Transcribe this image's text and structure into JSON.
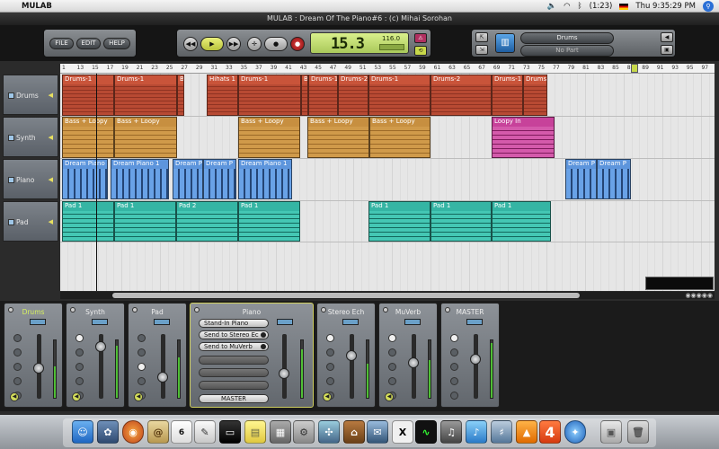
{
  "menubar": {
    "app_name": "MULAB",
    "battery": "(1:23)",
    "clock": "Thu 9:35:29 PM"
  },
  "window": {
    "title": "MULAB : Dream Of The Piano#6 : (c) Mihai Sorohan"
  },
  "toolbar": {
    "file_label": "FILE",
    "edit_label": "EDIT",
    "help_label": "HELP"
  },
  "transport": {
    "position": "15.3",
    "tempo": "116.0"
  },
  "instrument_panel": {
    "rack_name": "Drums",
    "part_name": "No Part"
  },
  "tracks": [
    {
      "name": "Drums"
    },
    {
      "name": "Synth"
    },
    {
      "name": "Piano"
    },
    {
      "name": "Pad"
    }
  ],
  "ruler": {
    "bars": [
      "1",
      "13",
      "15",
      "17",
      "19",
      "21",
      "23",
      "25",
      "27",
      "29",
      "31",
      "33",
      "35",
      "37",
      "39",
      "41",
      "43",
      "45",
      "47",
      "49",
      "51",
      "53",
      "55",
      "57",
      "59",
      "61",
      "63",
      "65",
      "67",
      "69",
      "71",
      "73",
      "75",
      "77",
      "79",
      "81",
      "83",
      "85",
      "87",
      "89",
      "91",
      "93",
      "95",
      "97"
    ]
  },
  "clips": {
    "drums": [
      "Drums-1",
      "Drums-1",
      "B",
      "Hihats 1",
      "Drums-1",
      "B",
      "Drums-1",
      "Drums-2",
      "Drums-1",
      "Drums-2",
      "Drums-1",
      "Drums"
    ],
    "synth": [
      "Bass + Loopy",
      "Bass + Loopy",
      "Bass + Loopy",
      "Bass + Loopy",
      "Bass + Loopy",
      "Bass + Loopy",
      "Loopy In"
    ],
    "piano": [
      "Dream Piano 1",
      "Dream Piano 1",
      "Dream P",
      "Dream P",
      "Dream Piano 1",
      "Dream P",
      "Dream P"
    ],
    "pad": [
      "Pad 1",
      "Pad 1",
      "Pad 2",
      "Pad 1",
      "Pad 1",
      "Pad 1",
      "Pad 1"
    ]
  },
  "mixer": {
    "strips": [
      {
        "name": "Drums",
        "meter_level": 0.55
      },
      {
        "name": "Synth",
        "meter_level": 0.9
      },
      {
        "name": "Pad",
        "meter_level": 0.7
      },
      {
        "name": "Piano",
        "meter_level": 0.85
      },
      {
        "name": "Stereo Ech",
        "meter_level": 0.6
      },
      {
        "name": "MuVerb",
        "meter_level": 0.65
      },
      {
        "name": "MASTER",
        "meter_level": 0.95
      }
    ],
    "piano_sends": {
      "instrument": "Stand-In Piano",
      "send1": "Send to Stereo Ec",
      "send2": "Send to MuVerb",
      "output": "MASTER"
    }
  },
  "dock": {
    "icons": [
      "finder-icon",
      "preview-icon",
      "firefox-icon",
      "mail-icon",
      "ical-icon",
      "textedit-icon",
      "terminal-icon",
      "stickies-icon",
      "misc-icon",
      "system-prefs-icon",
      "x11-icon",
      "activity-monitor-icon",
      "garageband-icon",
      "itunes-icon",
      "audio-midi-icon",
      "vlc-icon",
      "mulab-icon",
      "safari-icon",
      "folder-icon",
      "trash-icon"
    ],
    "ical_day": "6",
    "x11_label": "X",
    "mulab_label": "4"
  },
  "colors": {
    "drums": "#c9543a",
    "synth": "#c78f40",
    "synth_pink": "#c7429a",
    "piano": "#5d95dc",
    "pad": "#35b5a4",
    "lcd": "#c8e27a",
    "accent": "#d6f060"
  }
}
